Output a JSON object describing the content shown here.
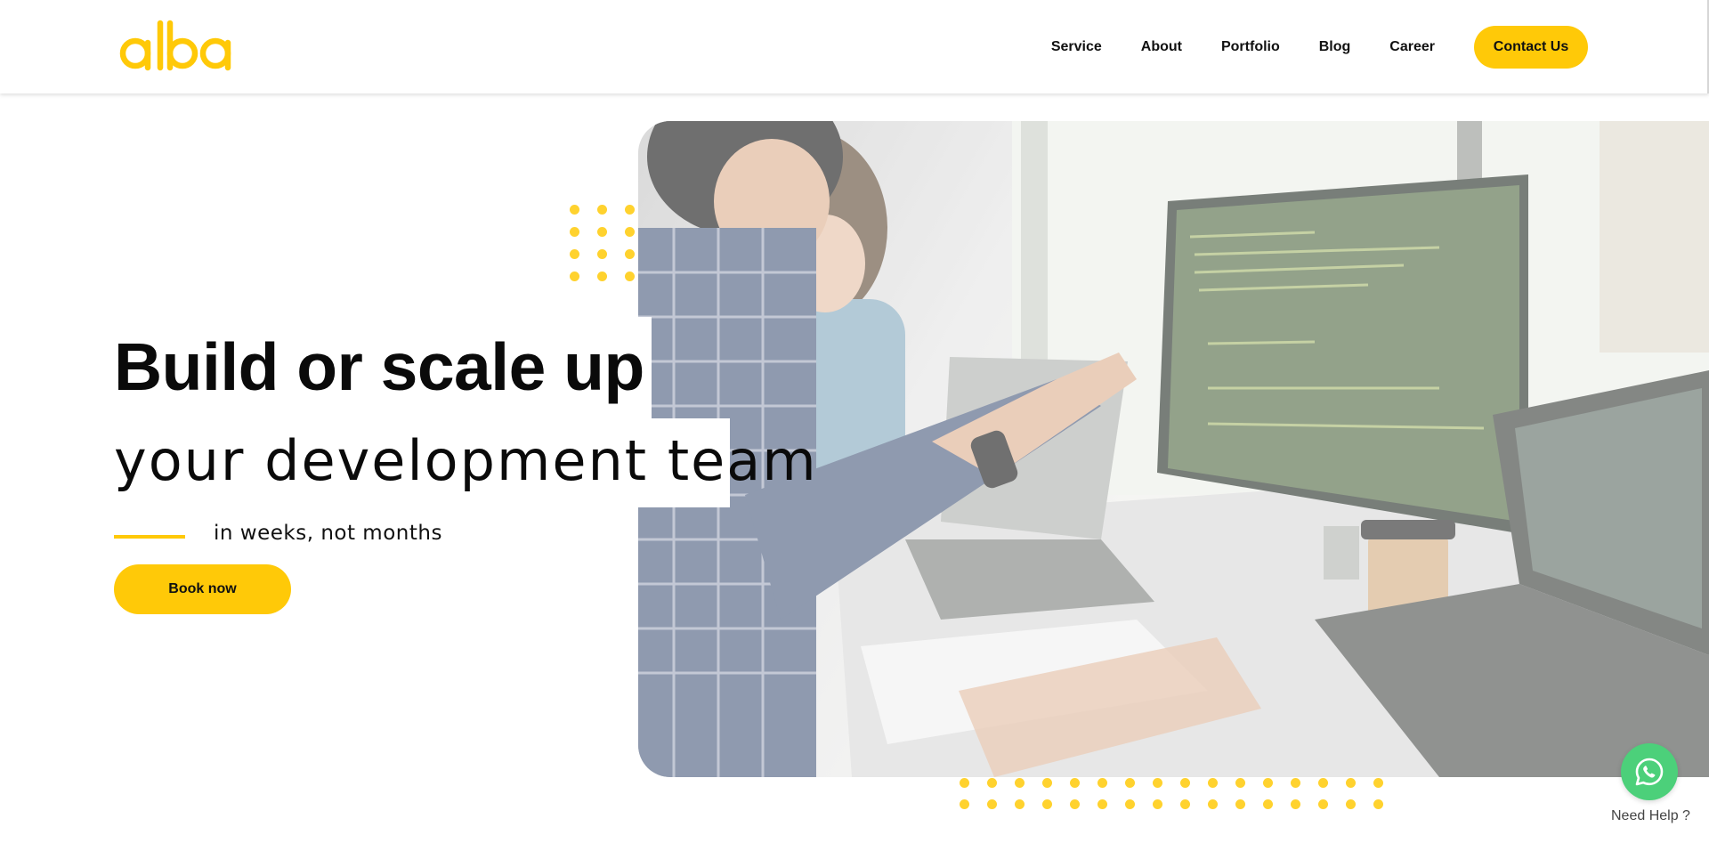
{
  "brand": {
    "logo_text": "alba",
    "accent_color": "#ffc908",
    "dot_color": "#ffd22e"
  },
  "nav": {
    "items": [
      {
        "label": "Service"
      },
      {
        "label": "About"
      },
      {
        "label": "Portfolio"
      },
      {
        "label": "Blog"
      },
      {
        "label": "Career"
      }
    ],
    "contact_label": "Contact Us"
  },
  "hero": {
    "headline_bold": "Build or scale up",
    "headline_light": "your development team",
    "subline": "in weeks, not months",
    "cta_label": "Book now",
    "image_description_icon": "team-coding-photo"
  },
  "help_widget": {
    "icon": "whatsapp-icon",
    "label": "Need Help ?",
    "color": "#4cd07a"
  }
}
